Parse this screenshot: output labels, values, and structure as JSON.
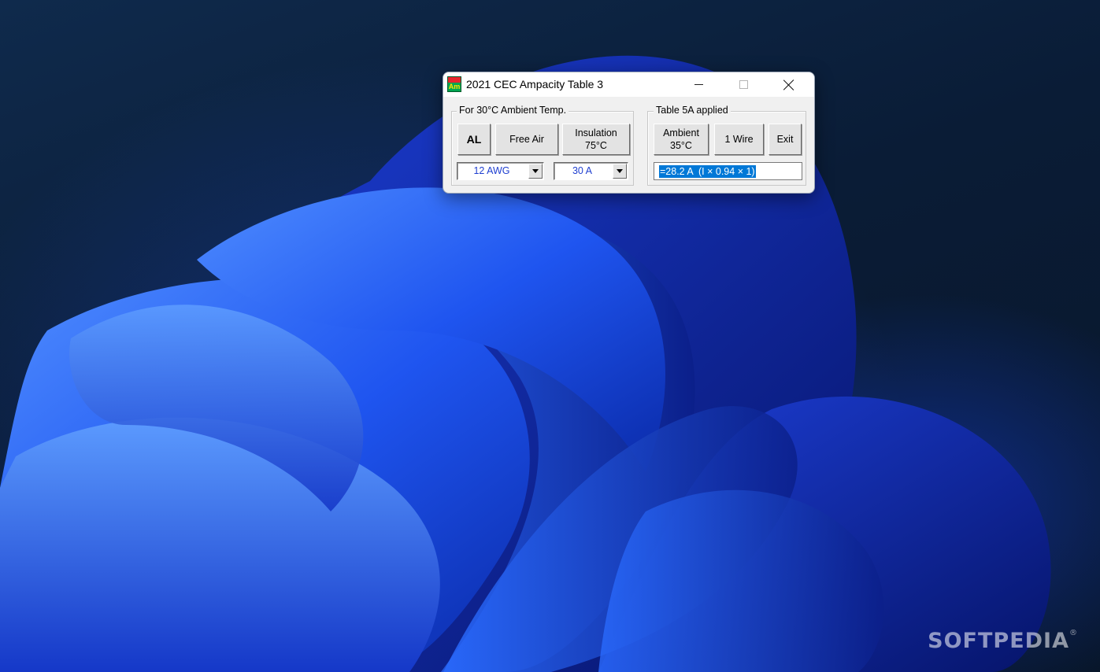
{
  "window": {
    "title": "2021 CEC Ampacity Table 3",
    "icon_top": "",
    "icon_bottom": "Am"
  },
  "left_group": {
    "legend": "For 30°C Ambient Temp.",
    "al_label": "AL",
    "free_air_label": "Free Air",
    "insulation_label": "Insulation\n75°C",
    "awg_value": "12 AWG",
    "amps_value": "30 A"
  },
  "right_group": {
    "legend": "Table 5A applied",
    "ambient_label": "Ambient\n35°C",
    "wire_label": "1 Wire",
    "exit_label": "Exit",
    "result_text": "=28.2 A  (I × 0.94 × 1)"
  },
  "watermark": {
    "text": "SOFTPEDIA",
    "mark": "®"
  },
  "colors": {
    "selection": "#0078d7",
    "combo_text": "#1f3fd0",
    "icon_green": "#00a650",
    "icon_red": "#e8262e"
  }
}
